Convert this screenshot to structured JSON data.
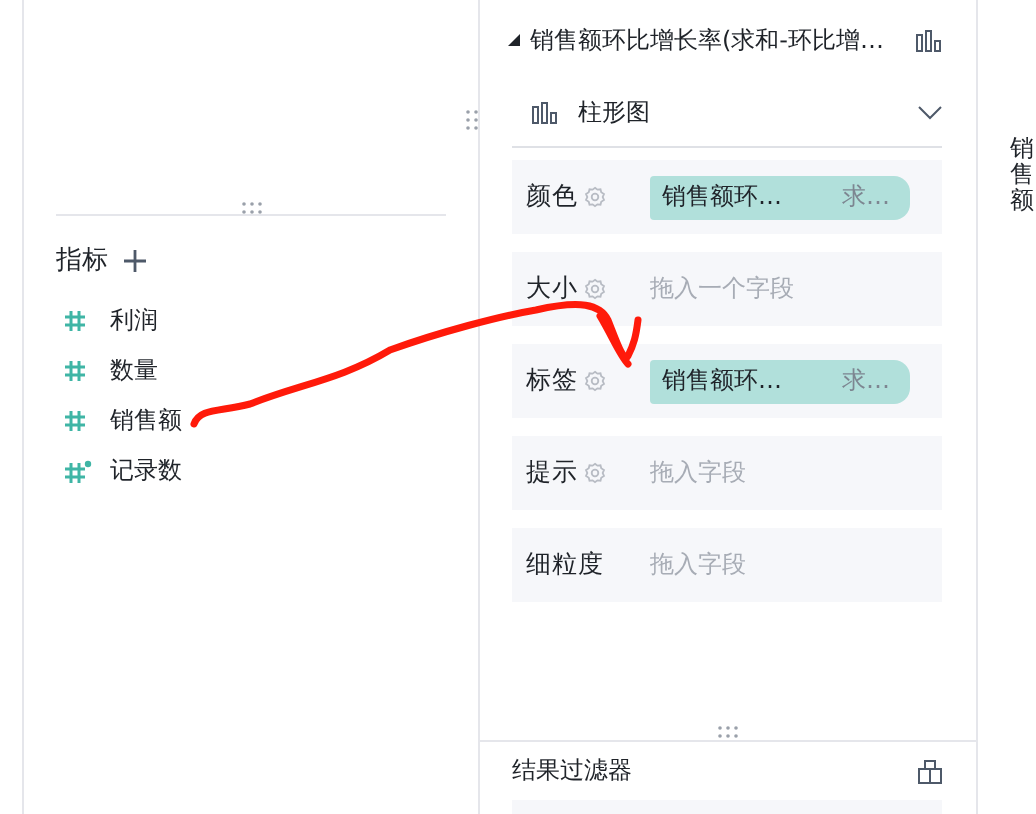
{
  "measures": {
    "title": "指标",
    "fields": [
      {
        "name": "利润",
        "kind": "measure"
      },
      {
        "name": "数量",
        "kind": "measure"
      },
      {
        "name": "销售额",
        "kind": "measure"
      },
      {
        "name": "记录数",
        "kind": "calculated"
      }
    ]
  },
  "chart_panel": {
    "title": "销售额环比增长率(求和-环比增…",
    "chart_type": "柱形图",
    "shelves": [
      {
        "label": "颜色",
        "settings": true,
        "field": {
          "name": "销售额环…",
          "aggregation": "求…"
        }
      },
      {
        "label": "大小",
        "settings": true,
        "placeholder": "拖入一个字段"
      },
      {
        "label": "标签",
        "settings": true,
        "field": {
          "name": "销售额环…",
          "aggregation": "求…"
        }
      },
      {
        "label": "提示",
        "settings": true,
        "placeholder": "拖入字段"
      },
      {
        "label": "细粒度",
        "settings": false,
        "placeholder": "拖入字段"
      }
    ],
    "filter_title": "结果过滤器"
  },
  "side_label": "销售额"
}
